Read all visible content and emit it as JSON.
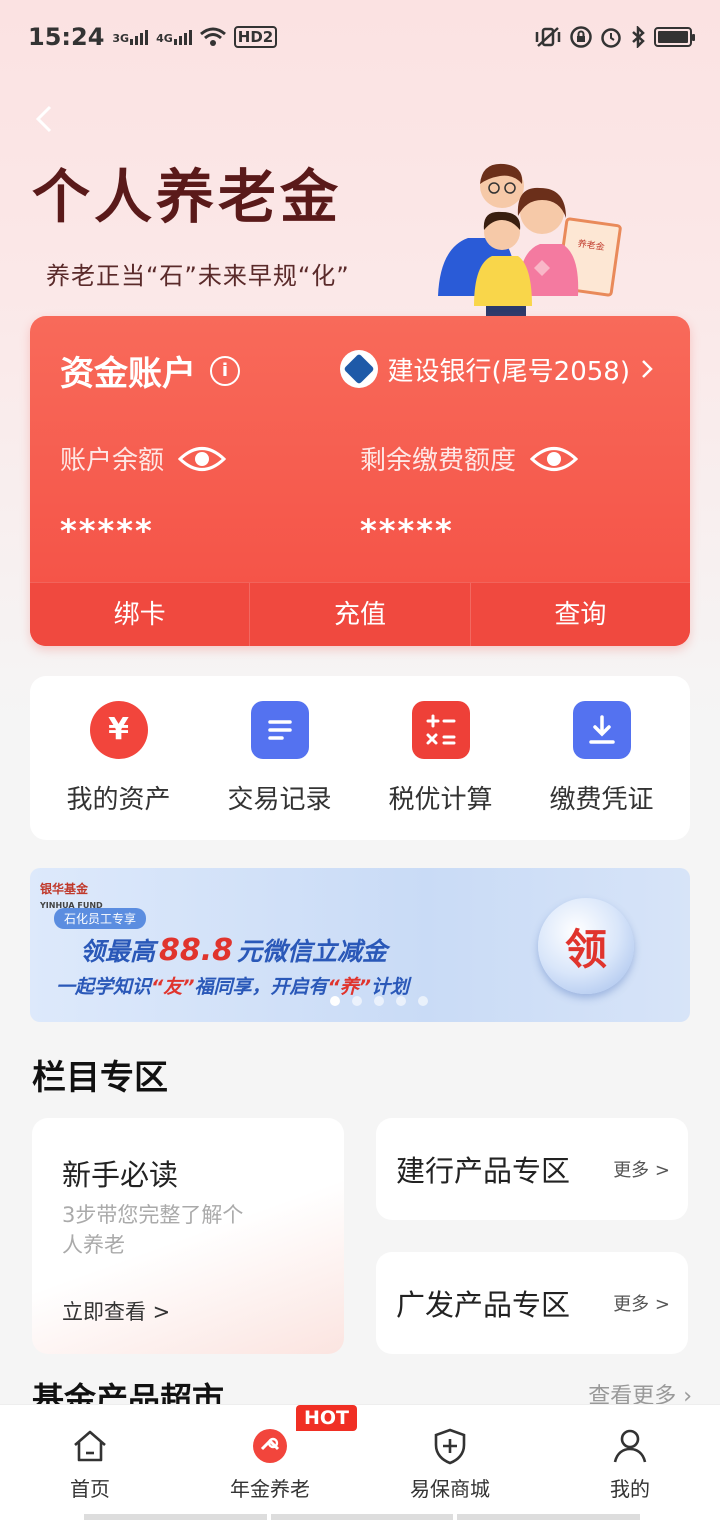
{
  "status_bar": {
    "time": "15:24",
    "net1": "3G",
    "net2": "4G",
    "hd": "HD2"
  },
  "hero": {
    "title": "个人养老金",
    "subtitle": "养老正当“石”未来早规“化”",
    "illus_doc": "养老金"
  },
  "account": {
    "title": "资金账户",
    "bank": "建设银行(尾号2058)",
    "balance_label": "账户余额",
    "quota_label": "剩余缴费额度",
    "balance_mask": "*****",
    "quota_mask": "*****",
    "actions": [
      "绑卡",
      "充值",
      "查询"
    ]
  },
  "quick": [
    {
      "label": "我的资产",
      "icon": "yen-icon",
      "glyph": "¥",
      "color": "#f2453c"
    },
    {
      "label": "交易记录",
      "icon": "document-icon",
      "glyph": "",
      "color": "#5472f0"
    },
    {
      "label": "税优计算",
      "icon": "calculator-icon",
      "glyph": "",
      "color": "#ee4038"
    },
    {
      "label": "缴费凭证",
      "icon": "download-icon",
      "glyph": "",
      "color": "#5472f0"
    }
  ],
  "banner": {
    "brand": "银华基金",
    "brand_en": "YINHUA FUND",
    "tag": "石化员工专享",
    "line1_a": "领最高",
    "line1_big": "88.8",
    "line1_b": "元微信立减金",
    "line2_a": "一起学知识",
    "line2_q1": "“友”",
    "line2_b": "福同享，开启有",
    "line2_q2": "“养”",
    "line2_c": "计划",
    "button": "领"
  },
  "section": {
    "title": "栏目专区",
    "newbie": {
      "title": "新手必读",
      "desc": "3步带您完整了解个人养老",
      "link": "立即查看 >"
    },
    "zones": [
      {
        "title": "建行产品专区",
        "more": "更多 >"
      },
      {
        "title": "广发产品专区",
        "more": "更多 >"
      }
    ]
  },
  "fund": {
    "title": "基金产品超市",
    "more": "查看更多 ›"
  },
  "tabs": [
    {
      "label": "首页",
      "icon": "home-icon"
    },
    {
      "label": "年金养老",
      "icon": "pension-icon",
      "badge": "HOT"
    },
    {
      "label": "易保商城",
      "icon": "shield-plus-icon"
    },
    {
      "label": "我的",
      "icon": "person-icon"
    }
  ]
}
